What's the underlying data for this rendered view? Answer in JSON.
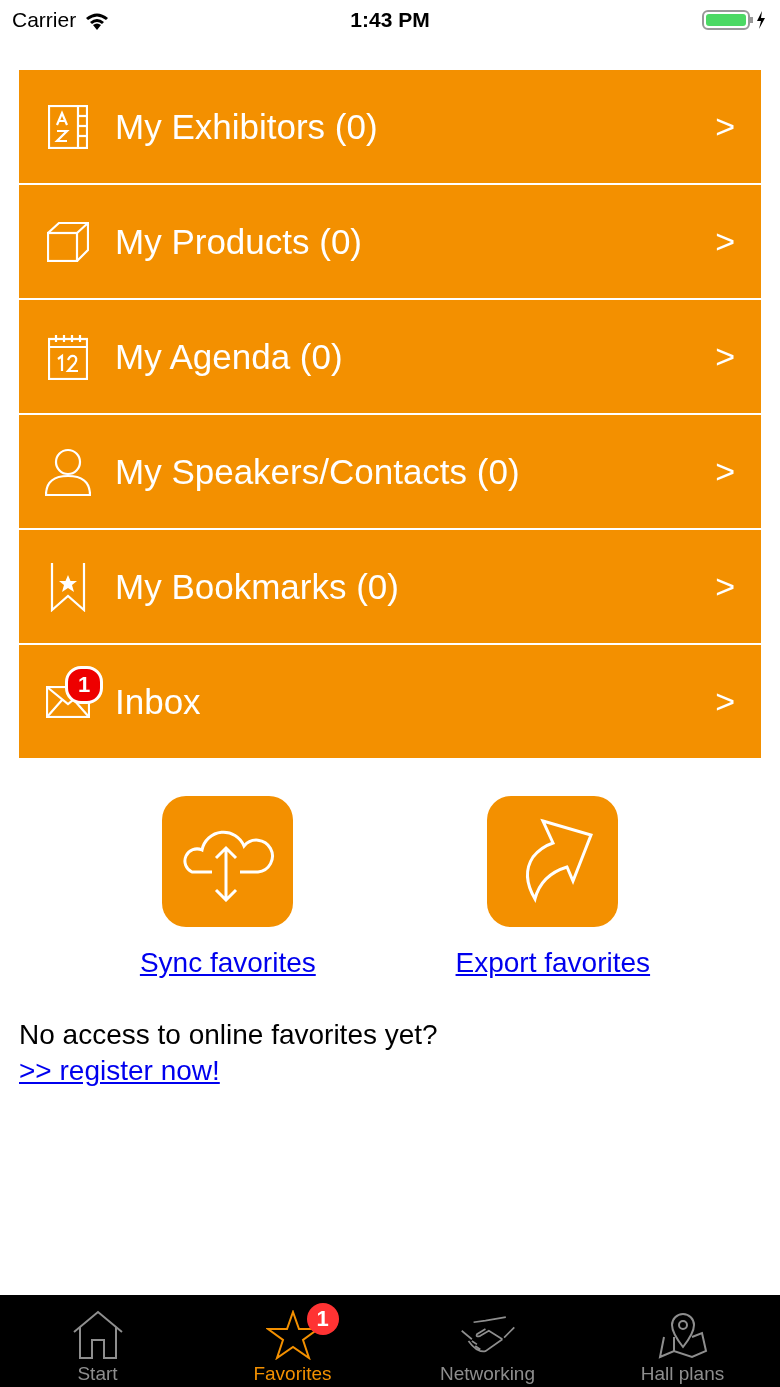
{
  "status_bar": {
    "carrier": "Carrier",
    "time": "1:43 PM"
  },
  "menu": [
    {
      "kind": "exhibitors",
      "label": "My Exhibitors (0)",
      "chevron": ">"
    },
    {
      "kind": "products",
      "label": "My Products (0)",
      "chevron": ">"
    },
    {
      "kind": "agenda",
      "label": "My Agenda (0)",
      "chevron": ">"
    },
    {
      "kind": "contacts",
      "label": "My Speakers/Contacts (0)",
      "chevron": ">"
    },
    {
      "kind": "bookmarks",
      "label": "My Bookmarks (0)",
      "chevron": ">"
    },
    {
      "kind": "inbox",
      "label": "Inbox",
      "badge": "1",
      "chevron": ">"
    }
  ],
  "actions": [
    {
      "kind": "sync",
      "label": "Sync favorites"
    },
    {
      "kind": "export",
      "label": "Export favorites"
    }
  ],
  "notice": {
    "text": "No access to online favorites yet?",
    "link": ">> register now!"
  },
  "tab_bar": [
    {
      "kind": "home",
      "label": "Start",
      "selected": false
    },
    {
      "kind": "star",
      "label": "Favorites",
      "selected": true,
      "badge": "1"
    },
    {
      "kind": "handshake",
      "label": "Networking",
      "selected": false
    },
    {
      "kind": "map",
      "label": "Hall plans",
      "selected": false
    }
  ]
}
